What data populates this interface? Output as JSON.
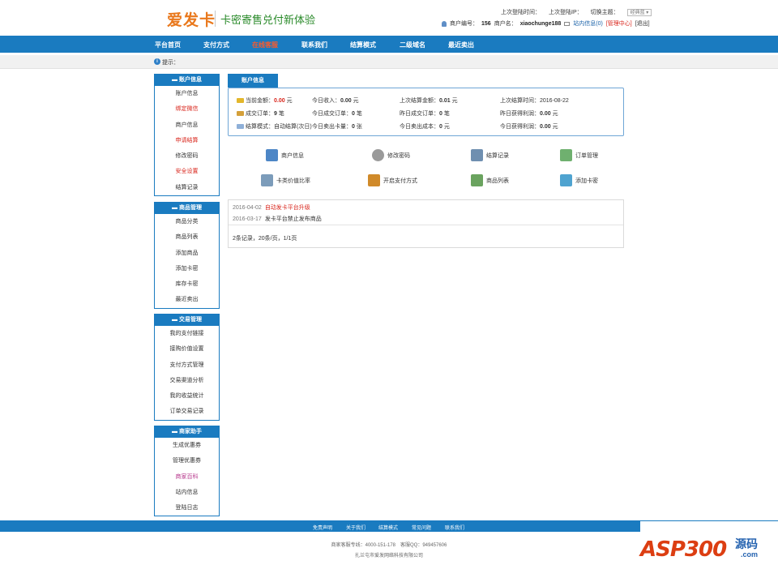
{
  "header": {
    "logo": "爱发卡",
    "slogan": "卡密寄售兑付新体验",
    "last_login_time": "上次登陆时间：",
    "last_login_ip": "上次登陆IP：",
    "switch_theme": "切换主题：",
    "theme_value": "经典蓝 ▾",
    "merchant_no_label": "商户编号：",
    "merchant_no": "156",
    "merchant_name_label": "商户名：",
    "merchant_name": "xiaochunge188",
    "inbox": "站内信息(0)",
    "manage": "[管理中心]",
    "logout": "[退出]"
  },
  "nav": [
    "平台首页",
    "支付方式",
    "在线客服",
    "联系我们",
    "结算模式",
    "二级域名",
    "最近卖出"
  ],
  "tip": "提示：",
  "sidebar": [
    {
      "title": "账户信息",
      "items": [
        "账户信息",
        "绑定微信",
        "商户信息",
        "申请结算",
        "修改密码",
        "安全设置",
        "结算记录"
      ]
    },
    {
      "title": "商品管理",
      "items": [
        "商品分类",
        "商品列表",
        "添加商品",
        "添加卡密",
        "库存卡密",
        "最近卖出"
      ]
    },
    {
      "title": "交易管理",
      "items": [
        "我的支付链接",
        "接购价值设置",
        "支付方式管理",
        "交易渠道分析",
        "我的收益统计",
        "订单交易记录"
      ]
    },
    {
      "title": "商家助手",
      "items": [
        "生成优惠券",
        "管理优惠券",
        "商家百科",
        "站内信息",
        "登陆日志"
      ]
    }
  ],
  "tab": "账户信息",
  "info": [
    [
      "当前金额：",
      "0.00",
      "元"
    ],
    [
      "今日收入：",
      "0.00",
      "元"
    ],
    [
      "上次结算金额：",
      "0.01",
      "元"
    ],
    [
      "上次结算时间：",
      "2016-08-22",
      ""
    ],
    [
      "成交订单：",
      "9",
      "笔"
    ],
    [
      "今日成交订单：",
      "0",
      "笔"
    ],
    [
      "昨日成交订单：",
      "0",
      "笔"
    ],
    [
      "昨日获得利润：",
      "0.00",
      "元"
    ],
    [
      "结算模式：",
      "自动结算(次日)",
      ""
    ],
    [
      "今日卖出卡量：",
      "0",
      "张"
    ],
    [
      "今日卖出成本：",
      "0",
      "元"
    ],
    [
      "今日获得利润：",
      "0.00",
      "元"
    ]
  ],
  "quick": [
    "商户信息",
    "修改密码",
    "结算记录",
    "订单管理",
    "卡类价值比率",
    "开启支付方式",
    "商品列表",
    "添加卡密"
  ],
  "news": [
    {
      "date": "2016-04-02",
      "title": "自动发卡平台升级"
    },
    {
      "date": "2016-03-17",
      "title": "发卡平台禁止发布商品"
    }
  ],
  "pager": "2条记录，20条/页，1/1页",
  "footer": {
    "links": [
      "免责声明",
      "关于我们",
      "结算模式",
      "常见问题",
      "联系我们"
    ],
    "line1": "商家客服专线：4000-151-178　客服QQ：949457606",
    "line2": "扎兰屯市爱发网络科技有限公司"
  },
  "watermark": {
    "text": "ASP300",
    "cn": "源码",
    "com": ".com"
  },
  "colors": {
    "nav": "#1a7bc0",
    "accent": "#d9261c"
  }
}
